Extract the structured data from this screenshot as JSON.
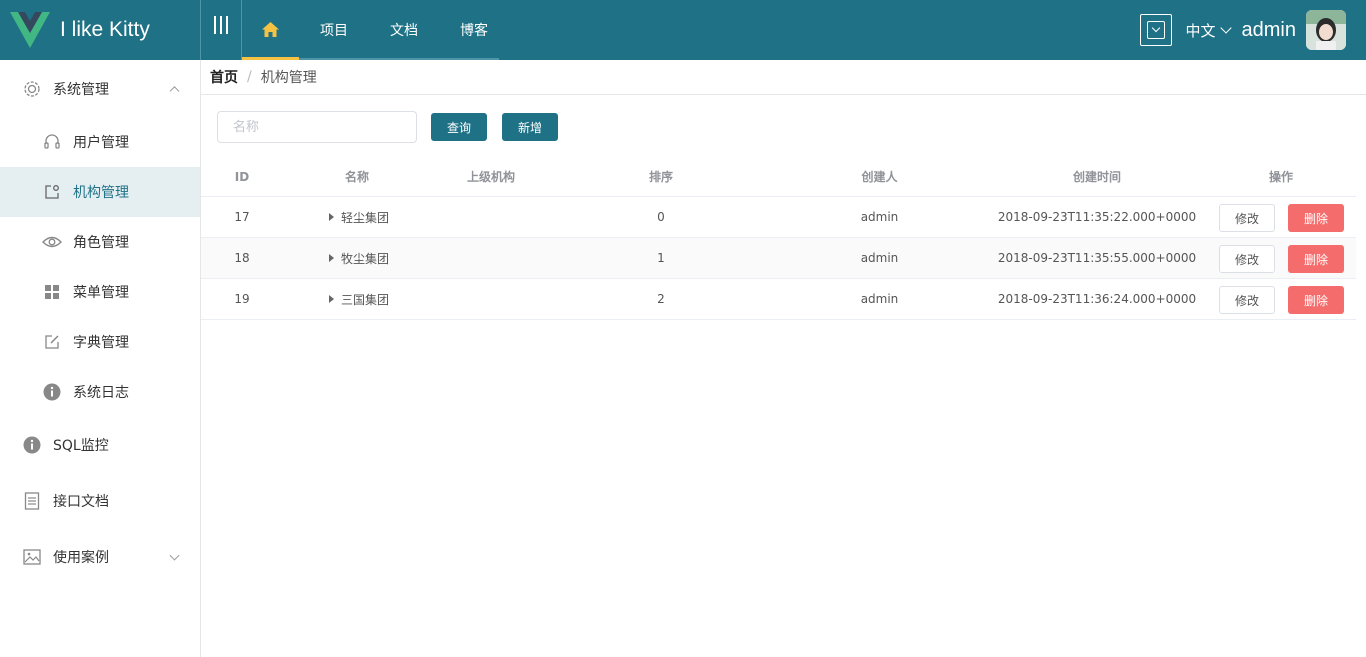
{
  "colors": {
    "header_bg": "#1f7286",
    "accent": "#1f7286",
    "home_underline": "#f5c243",
    "danger": "#f56c6c",
    "active_menu_bg": "#e5eff2"
  },
  "header": {
    "brand": "I like Kitty",
    "logo_icon": "vue-logo-icon",
    "nav": [
      {
        "icon": "home-icon",
        "label": ""
      },
      {
        "label": "项目"
      },
      {
        "label": "文档"
      },
      {
        "label": "博客"
      }
    ],
    "language": "中文",
    "username": "admin"
  },
  "sidebar": {
    "items": [
      {
        "label": "系统管理",
        "icon": "gear-icon",
        "level": 1,
        "expanded": true
      },
      {
        "label": "用户管理",
        "icon": "headset-icon",
        "level": 2
      },
      {
        "label": "机构管理",
        "icon": "org-icon",
        "level": 2,
        "active": true
      },
      {
        "label": "角色管理",
        "icon": "eye-icon",
        "level": 2
      },
      {
        "label": "菜单管理",
        "icon": "grid-icon",
        "level": 2
      },
      {
        "label": "字典管理",
        "icon": "edit-icon",
        "level": 2
      },
      {
        "label": "系统日志",
        "icon": "info-icon",
        "level": 2
      },
      {
        "label": "SQL监控",
        "icon": "info-icon",
        "level": 1
      },
      {
        "label": "接口文档",
        "icon": "document-icon",
        "level": 1
      },
      {
        "label": "使用案例",
        "icon": "picture-icon",
        "level": 1,
        "expanded": false
      }
    ]
  },
  "breadcrumb": {
    "home": "首页",
    "separator": "/",
    "current": "机构管理"
  },
  "toolbar": {
    "search_placeholder": "名称",
    "query_label": "查询",
    "add_label": "新增"
  },
  "table": {
    "columns": {
      "id": "ID",
      "name": "名称",
      "parent": "上级机构",
      "order": "排序",
      "creator": "创建人",
      "time": "创建时间",
      "ops": "操作"
    },
    "rows": [
      {
        "id": "17",
        "name": "轻尘集团",
        "parent": "",
        "order": "0",
        "creator": "admin",
        "time": "2018-09-23T11:35:22.000+0000"
      },
      {
        "id": "18",
        "name": "牧尘集团",
        "parent": "",
        "order": "1",
        "creator": "admin",
        "time": "2018-09-23T11:35:55.000+0000"
      },
      {
        "id": "19",
        "name": "三国集团",
        "parent": "",
        "order": "2",
        "creator": "admin",
        "time": "2018-09-23T11:36:24.000+0000"
      }
    ],
    "edit_label": "修改",
    "delete_label": "删除"
  }
}
